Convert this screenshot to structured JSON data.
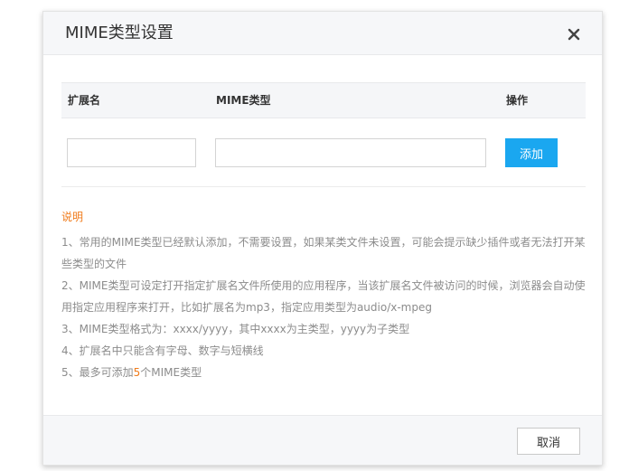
{
  "dialog": {
    "title": "MIME类型设置",
    "close_icon": "close-icon"
  },
  "table": {
    "columns": [
      "扩展名",
      "MIME类型",
      "操作"
    ],
    "row": {
      "extension_value": "",
      "mime_value": "",
      "add_label": "添加"
    }
  },
  "notes": {
    "title": "说明",
    "items": [
      "1、常用的MIME类型已经默认添加，不需要设置，如果某类文件未设置，可能会提示缺少插件或者无法打开某些类型的文件",
      "2、MIME类型可设定打开指定扩展名文件所使用的应用程序，当该扩展名文件被访问的时候，浏览器会自动使用指定应用程序来打开，比如扩展名为mp3，指定应用类型为audio/x-mpeg",
      "3、MIME类型格式为：xxxx/yyyy，其中xxxx为主类型，yyyy为子类型",
      "4、扩展名中只能含有字母、数字与短横线"
    ],
    "item5": {
      "before": "5、最多可添加",
      "highlight": "5",
      "after": "个MIME类型"
    }
  },
  "footer": {
    "cancel_label": "取消"
  },
  "colors": {
    "accent": "#1aa7f0",
    "notice": "#f07b1b",
    "note_text": "#8c8c8c"
  }
}
